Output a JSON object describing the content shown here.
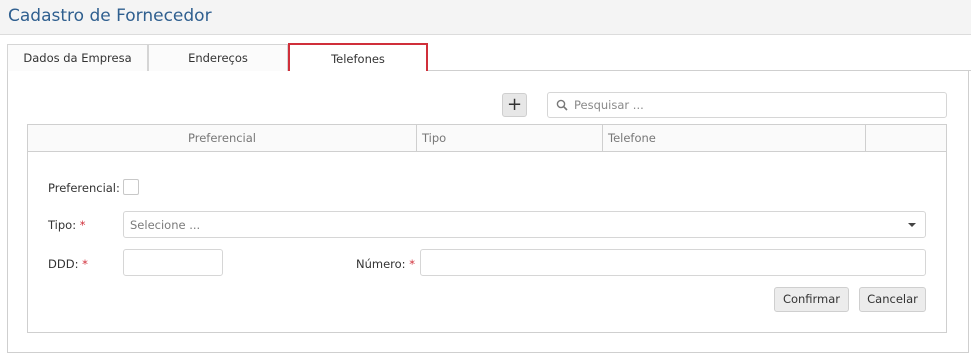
{
  "header": {
    "title": "Cadastro de Fornecedor"
  },
  "tabs": [
    {
      "label": "Dados da Empresa"
    },
    {
      "label": "Endereços"
    },
    {
      "label": "Telefones",
      "active": true
    }
  ],
  "toolbar": {
    "add_label": "+",
    "search_placeholder": "Pesquisar ..."
  },
  "grid": {
    "columns": [
      "Preferencial",
      "Tipo",
      "Telefone",
      ""
    ]
  },
  "form": {
    "preferencial_label": "Preferencial:",
    "tipo_label": "Tipo:",
    "tipo_placeholder": "Selecione ...",
    "ddd_label": "DDD:",
    "numero_label": "Número:",
    "required_mark": "*",
    "confirm_label": "Confirmar",
    "cancel_label": "Cancelar"
  },
  "colors": {
    "title": "#2f5f8f",
    "active_tab_border": "#d02f3a",
    "required": "#d02f3a"
  },
  "icons": {
    "search": "search-icon",
    "dropdown": "chevron-down-icon"
  }
}
